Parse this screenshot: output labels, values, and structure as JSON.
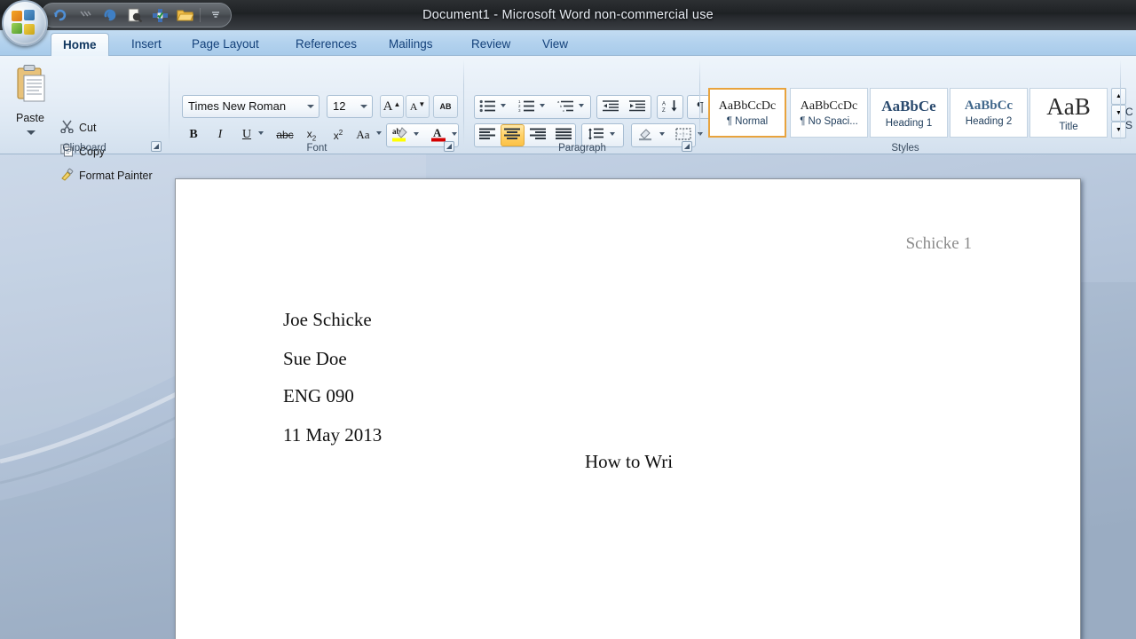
{
  "window": {
    "title": "Document1 - Microsoft Word non-commercial use"
  },
  "office_button": {
    "label": "Office Button",
    "icon": "office-orb-icon"
  },
  "quick_access_toolbar": {
    "items": [
      {
        "label": "Undo",
        "icon": "undo-icon"
      },
      {
        "label": "Redo",
        "icon": "redo-icon"
      },
      {
        "label": "Save",
        "icon": "save-icon"
      },
      {
        "label": "Print Preview",
        "icon": "print-preview-icon"
      },
      {
        "label": "Spelling & Grammar",
        "icon": "spelling-grammar-icon"
      },
      {
        "label": "Open",
        "icon": "open-folder-icon"
      },
      {
        "label": "Customize Quick Access Toolbar",
        "icon": "chevron-down-icon"
      }
    ]
  },
  "ribbon": {
    "tabs": [
      {
        "label": "Home",
        "active": true
      },
      {
        "label": "Insert",
        "active": false
      },
      {
        "label": "Page Layout",
        "active": false
      },
      {
        "label": "References",
        "active": false
      },
      {
        "label": "Mailings",
        "active": false
      },
      {
        "label": "Review",
        "active": false
      },
      {
        "label": "View",
        "active": false
      }
    ],
    "groups": {
      "clipboard": {
        "label": "Clipboard",
        "paste_label": "Paste",
        "commands": [
          {
            "label": "Cut",
            "icon": "scissors-icon"
          },
          {
            "label": "Copy",
            "icon": "copy-icon"
          },
          {
            "label": "Format Painter",
            "icon": "paintbrush-icon"
          }
        ],
        "dialog_launcher": "Clipboard dialog launcher"
      },
      "font": {
        "label": "Font",
        "font_name": "Times New Roman",
        "font_size": "12",
        "buttons": [
          {
            "label": "Grow Font",
            "icon": "grow-font-icon",
            "glyph": "A"
          },
          {
            "label": "Shrink Font",
            "icon": "shrink-font-icon",
            "glyph": "A"
          },
          {
            "label": "Clear Formatting",
            "icon": "clear-formatting-icon",
            "glyph": "AB"
          },
          {
            "label": "Bold",
            "icon": "bold-icon",
            "glyph": "B"
          },
          {
            "label": "Italic",
            "icon": "italic-icon",
            "glyph": "I"
          },
          {
            "label": "Underline",
            "icon": "underline-icon",
            "glyph": "U"
          },
          {
            "label": "Strikethrough",
            "icon": "strikethrough-icon",
            "glyph": "abc"
          },
          {
            "label": "Subscript",
            "icon": "subscript-icon",
            "glyph": "x"
          },
          {
            "label": "Superscript",
            "icon": "superscript-icon",
            "glyph": "x"
          },
          {
            "label": "Change Case",
            "icon": "change-case-icon",
            "glyph": "Aa"
          },
          {
            "label": "Text Highlight Color",
            "icon": "highlight-icon",
            "glyph": "ab"
          },
          {
            "label": "Font Color",
            "icon": "font-color-icon",
            "glyph": "A"
          }
        ],
        "highlight_color": "#ffff00",
        "font_color": "#d40000",
        "dialog_launcher": "Font dialog launcher"
      },
      "paragraph": {
        "label": "Paragraph",
        "buttons": [
          {
            "label": "Bullets",
            "icon": "bullets-icon"
          },
          {
            "label": "Numbering",
            "icon": "numbering-icon"
          },
          {
            "label": "Multilevel List",
            "icon": "multilevel-list-icon"
          },
          {
            "label": "Decrease Indent",
            "icon": "decrease-indent-icon"
          },
          {
            "label": "Increase Indent",
            "icon": "increase-indent-icon"
          },
          {
            "label": "Sort",
            "icon": "sort-az-icon"
          },
          {
            "label": "Show/Hide Formatting Marks",
            "icon": "pilcrow-icon",
            "glyph": "¶"
          },
          {
            "label": "Align Text Left",
            "icon": "align-left-icon"
          },
          {
            "label": "Center",
            "icon": "align-center-icon",
            "active": true
          },
          {
            "label": "Align Text Right",
            "icon": "align-right-icon"
          },
          {
            "label": "Justify",
            "icon": "align-justify-icon"
          },
          {
            "label": "Line Spacing",
            "icon": "line-spacing-icon"
          },
          {
            "label": "Shading",
            "icon": "shading-icon"
          },
          {
            "label": "Borders",
            "icon": "borders-icon"
          }
        ],
        "dialog_launcher": "Paragraph dialog launcher"
      },
      "styles": {
        "label": "Styles",
        "gallery": [
          {
            "preview": "AaBbCcDc",
            "name": "¶ Normal",
            "selected": true
          },
          {
            "preview": "AaBbCcDc",
            "name": "¶ No Spaci...",
            "selected": false
          },
          {
            "preview": "AaBbCе",
            "name": "Heading 1",
            "selected": false
          },
          {
            "preview": "AaBbCc",
            "name": "Heading 2",
            "selected": false
          },
          {
            "preview": "AaB",
            "name": "Title",
            "selected": false
          }
        ],
        "scroll_up": "Scroll up styles",
        "scroll_down": "Scroll down styles",
        "more": "More styles",
        "change_styles_label": "Change\nStyles"
      }
    }
  },
  "document": {
    "header_text": "Schicke 1",
    "lines": [
      "Joe Schicke",
      "Sue Doe",
      "ENG 090",
      "11 May 2013"
    ],
    "title_line": "How to Wri"
  }
}
